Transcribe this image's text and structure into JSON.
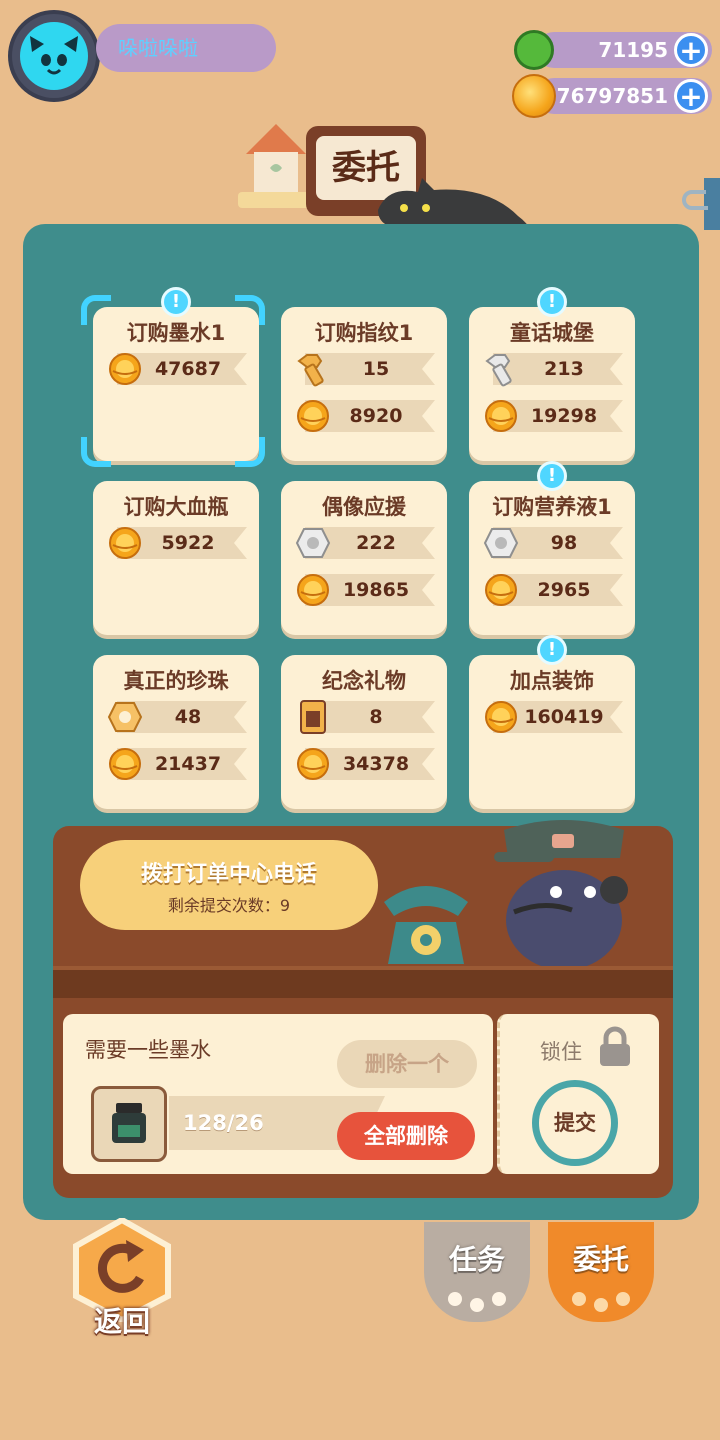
{
  "player": {
    "name": "哚啦哚啦"
  },
  "currencies": [
    {
      "icon": "green-gem-icon",
      "value": "71195"
    },
    {
      "icon": "gold-coin-icon",
      "value": "76797851"
    }
  ],
  "title": "委托",
  "orders": [
    {
      "title": "订购墨水1",
      "badge": true,
      "selected": true,
      "rows": [
        {
          "icon": "gold-coin-icon",
          "value": "47687"
        }
      ]
    },
    {
      "title": "订购指纹1",
      "badge": false,
      "selected": false,
      "rows": [
        {
          "icon": "gold-bolt-icon",
          "value": "15"
        },
        {
          "icon": "gold-coin-icon",
          "value": "8920"
        }
      ]
    },
    {
      "title": "童话城堡",
      "badge": true,
      "selected": false,
      "rows": [
        {
          "icon": "silver-bolt-icon",
          "value": "213"
        },
        {
          "icon": "gold-coin-icon",
          "value": "19298"
        }
      ]
    },
    {
      "title": "订购大血瓶",
      "badge": false,
      "selected": false,
      "rows": [
        {
          "icon": "gold-coin-icon",
          "value": "5922"
        }
      ]
    },
    {
      "title": "偶像应援",
      "badge": false,
      "selected": false,
      "rows": [
        {
          "icon": "silver-nut-icon",
          "value": "222"
        },
        {
          "icon": "gold-coin-icon",
          "value": "19865"
        }
      ]
    },
    {
      "title": "订购营养液1",
      "badge": true,
      "selected": false,
      "rows": [
        {
          "icon": "silver-nut-icon",
          "value": "98"
        },
        {
          "icon": "gold-coin-icon",
          "value": "2965"
        }
      ]
    },
    {
      "title": "真正的珍珠",
      "badge": false,
      "selected": false,
      "rows": [
        {
          "icon": "gold-nut-icon",
          "value": "48"
        },
        {
          "icon": "gold-coin-icon",
          "value": "21437"
        }
      ]
    },
    {
      "title": "纪念礼物",
      "badge": false,
      "selected": false,
      "rows": [
        {
          "icon": "battery-icon",
          "value": "8"
        },
        {
          "icon": "gold-coin-icon",
          "value": "34378"
        }
      ]
    },
    {
      "title": "加点装饰",
      "badge": true,
      "selected": false,
      "rows": [
        {
          "icon": "gold-coin-icon",
          "value": "160419"
        }
      ]
    }
  ],
  "phone_bubble": {
    "title": "拨打订单中心电话",
    "remaining": "剩余提交次数：9"
  },
  "order_detail": {
    "title": "需要一些墨水",
    "item_icon": "ink-bottle-icon",
    "quantity": "128/26",
    "delete_one": "删除一个",
    "delete_all": "全部删除"
  },
  "lock": {
    "label": "锁住",
    "submit": "提交"
  },
  "nav": {
    "back": "返回",
    "tasks": "任务",
    "commission": "委托"
  },
  "colors": {
    "panel": "#3f8d8c",
    "card": "#fdf0d4",
    "delete_all": "#e7533c",
    "commission_tab": "#f08a2a",
    "tasks_tab": "#b9ada2"
  }
}
